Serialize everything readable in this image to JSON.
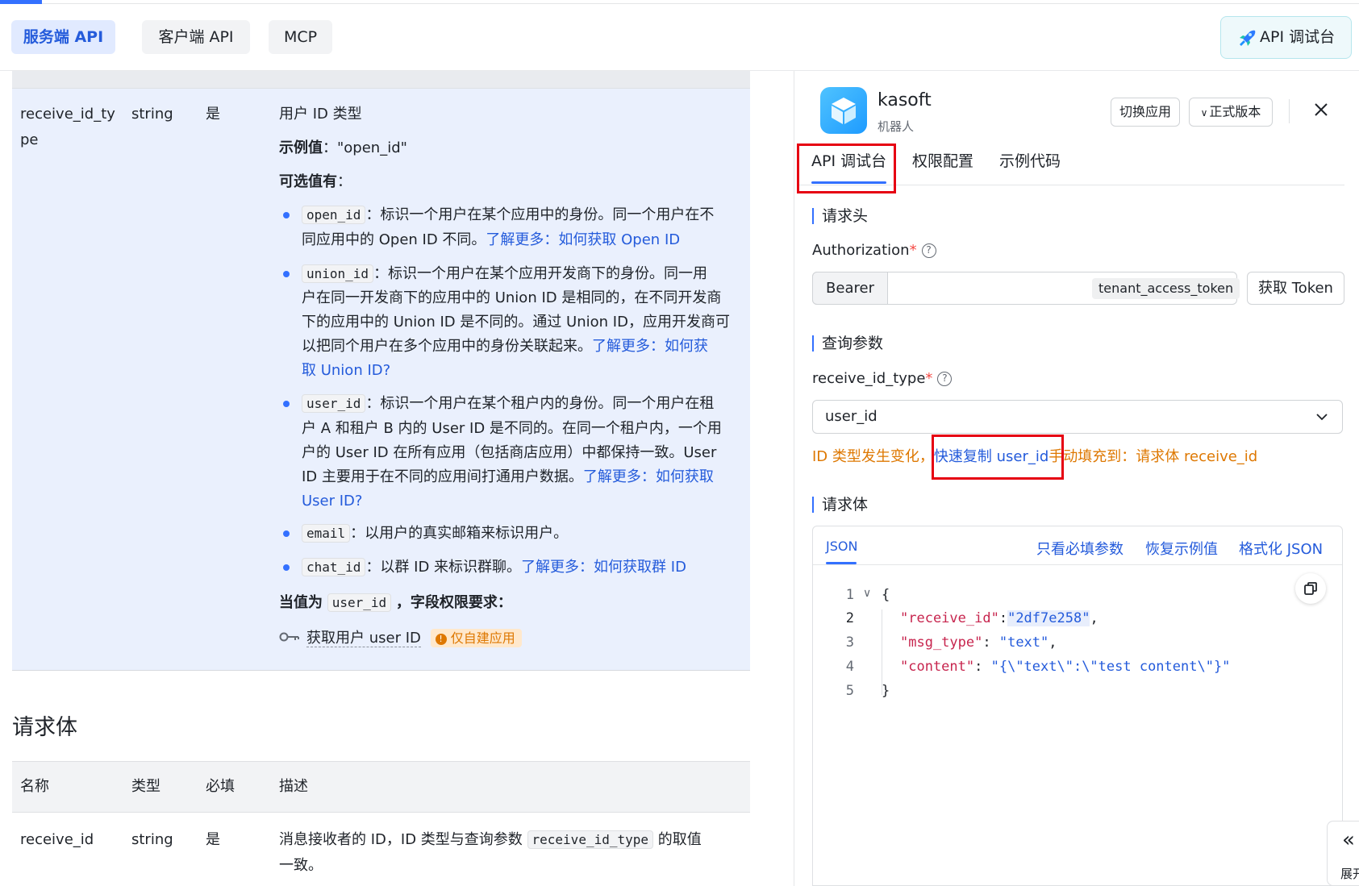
{
  "nav": {
    "tabs": [
      "服务端 API",
      "客户端 API",
      "MCP"
    ],
    "console_button": "API 调试台"
  },
  "param": {
    "name": "receive_id_type",
    "type": "string",
    "required": "是",
    "desc_title": "用户 ID 类型",
    "example_label": "示例值",
    "example_value": "\"open_id\"",
    "options_label": "可选值有",
    "options": [
      {
        "code": "open_id",
        "text1": "：标识一个用户在某个应用中的身份。同一个用户在不",
        "text2": "同应用中的 Open ID 不同。",
        "link": "了解更多：如何获取 Open ID"
      },
      {
        "code": "union_id",
        "text1": "：标识一个用户在某个应用开发商下的身份。同一用",
        "text2": "户在同一开发商下的应用中的 Union ID 是相同的，在不同开发商",
        "text3": "下的应用中的 Union ID 是不同的。通过 Union ID，应用开发商可",
        "text4": "以把同个用户在多个应用中的身份关联起来。",
        "link1": "了解更多：如何获",
        "link2": "取 Union ID?"
      },
      {
        "code": "user_id",
        "text1": "：标识一个用户在某个租户内的身份。同一个用户在租",
        "text2": "户 A 和租户 B 内的 User ID 是不同的。在同一个租户内，一个用",
        "text3": "户的 User ID 在所有应用（包括商店应用）中都保持一致。User",
        "text4": "ID 主要用于在不同的应用间打通用户数据。",
        "link1": "了解更多：如何获取",
        "link2": "User ID?"
      },
      {
        "code": "email",
        "text1": "：以用户的真实邮箱来标识用户。"
      },
      {
        "code": "chat_id",
        "text1": "：以群 ID 来标识群聊。",
        "link": "了解更多：如何获取群 ID"
      }
    ],
    "perm_prefix": "当值为",
    "perm_code": "user_id",
    "perm_suffix": "，字段权限要求",
    "perm_name": "获取用户 user ID",
    "perm_badge": "仅自建应用"
  },
  "reqbody": {
    "title": "请求体",
    "headers": [
      "名称",
      "类型",
      "必填",
      "描述"
    ],
    "row": {
      "name": "receive_id",
      "type": "string",
      "required": "是",
      "desc1": "消息接收者的 ID，ID 类型与查询参数",
      "desc_code": "receive_id_type",
      "desc2": "的取值",
      "desc3": "一致。"
    }
  },
  "app": {
    "name": "kasoft",
    "role": "机器人",
    "switch_btn": "切换应用",
    "version_btn": "正式版本"
  },
  "right_tabs": [
    "API 调试台",
    "权限配置",
    "示例代码"
  ],
  "headers_section": "请求头",
  "auth": {
    "label": "Authorization",
    "prefix": "Bearer",
    "token_type": "tenant_access_token",
    "get_token": "获取 Token"
  },
  "query_section": "查询参数",
  "query": {
    "label": "receive_id_type",
    "value": "user_id",
    "hint1": "ID 类型发生变化，",
    "hint_link": "快速复制 user_id",
    "hint2": "手动填充到：请求体 receive_id"
  },
  "body_section": "请求体",
  "editor": {
    "tab": "JSON",
    "actions": [
      "只看必填参数",
      "恢复示例值",
      "格式化 JSON"
    ],
    "lines": [
      {
        "n": "1",
        "code": "{"
      },
      {
        "n": "2",
        "key": "\"receive_id\"",
        "sep": ":",
        "val": "\"2df7e258\"",
        "end": ","
      },
      {
        "n": "3",
        "key": "\"msg_type\"",
        "sep": ": ",
        "val": "\"text\"",
        "end": ","
      },
      {
        "n": "4",
        "key": "\"content\"",
        "sep": ": ",
        "val": "\"{\\\"text\\\":\\\"test content\\\"}\"",
        "end": ""
      },
      {
        "n": "5",
        "code": "}"
      }
    ]
  },
  "collapse_label": "展开",
  "colors": {
    "primary": "#3370ff",
    "link": "#245bdb",
    "warn": "#de7802",
    "highlight_box": "#e60012"
  }
}
